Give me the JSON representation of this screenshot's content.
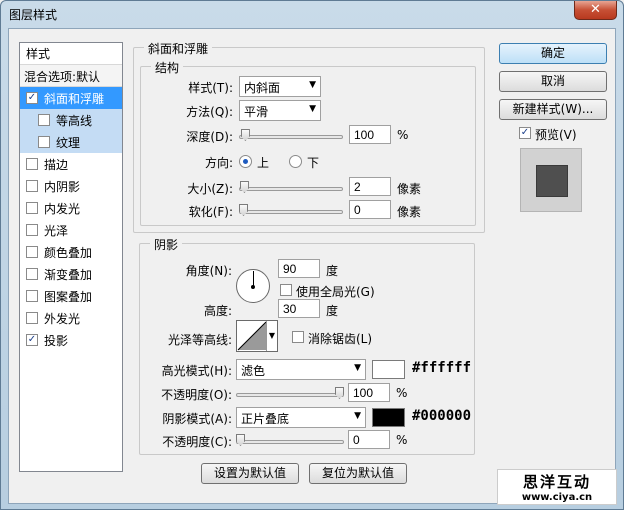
{
  "window": {
    "title": "图层样式",
    "close_glyph": "✕"
  },
  "style_list": {
    "header": "样式",
    "blend": "混合选项:默认",
    "items": [
      {
        "label": "斜面和浮雕",
        "checked": true
      },
      {
        "label": "等高线",
        "checked": false
      },
      {
        "label": "纹理",
        "checked": false
      },
      {
        "label": "描边",
        "checked": false
      },
      {
        "label": "内阴影",
        "checked": false
      },
      {
        "label": "内发光",
        "checked": false
      },
      {
        "label": "光泽",
        "checked": false
      },
      {
        "label": "颜色叠加",
        "checked": false
      },
      {
        "label": "渐变叠加",
        "checked": false
      },
      {
        "label": "图案叠加",
        "checked": false
      },
      {
        "label": "外发光",
        "checked": false
      },
      {
        "label": "投影",
        "checked": true
      }
    ]
  },
  "bevel": {
    "title": "斜面和浮雕",
    "structure_title": "结构",
    "style_label": "样式(T):",
    "style_value": "内斜面",
    "technique_label": "方法(Q):",
    "technique_value": "平滑",
    "depth_label": "深度(D):",
    "depth_value": "100",
    "depth_unit": "%",
    "direction_label": "方向:",
    "dir_up": "上",
    "dir_down": "下",
    "size_label": "大小(Z):",
    "size_value": "2",
    "size_unit": "像素",
    "soften_label": "软化(F):",
    "soften_value": "0",
    "soften_unit": "像素",
    "depth_level": 0.02,
    "size_level": 0.01,
    "soften_level": 0.0
  },
  "shading": {
    "title": "阴影",
    "angle_label": "角度(N):",
    "angle_value": "90",
    "angle_unit": "度",
    "global_light_label": "使用全局光(G)",
    "altitude_label": "高度:",
    "altitude_value": "30",
    "altitude_unit": "度",
    "gloss_label": "光泽等高线:",
    "antialias_label": "消除锯齿(L)",
    "highlight_mode_label": "高光模式(H):",
    "highlight_mode_value": "滤色",
    "highlight_color": "#ffffff",
    "highlight_hex_text": "#ffffff",
    "highlight_opacity_label": "不透明度(O):",
    "highlight_opacity_value": "100",
    "highlight_opacity_unit": "%",
    "shadow_mode_label": "阴影模式(A):",
    "shadow_mode_value": "正片叠底",
    "shadow_color": "#000000",
    "shadow_hex_text": "#000000",
    "shadow_opacity_label": "不透明度(C):",
    "shadow_opacity_value": "0",
    "shadow_opacity_unit": "%",
    "highlight_opacity_level": 1.0,
    "shadow_opacity_level": 0.0
  },
  "footer": {
    "set_default": "设置为默认值",
    "reset_default": "复位为默认值"
  },
  "side": {
    "ok": "确定",
    "cancel": "取消",
    "new_style": "新建样式(W)...",
    "preview_label": "预览(V)",
    "preview_checked": true
  },
  "watermark": {
    "brand": "思洋互动",
    "url": "www.ciya.cn"
  }
}
